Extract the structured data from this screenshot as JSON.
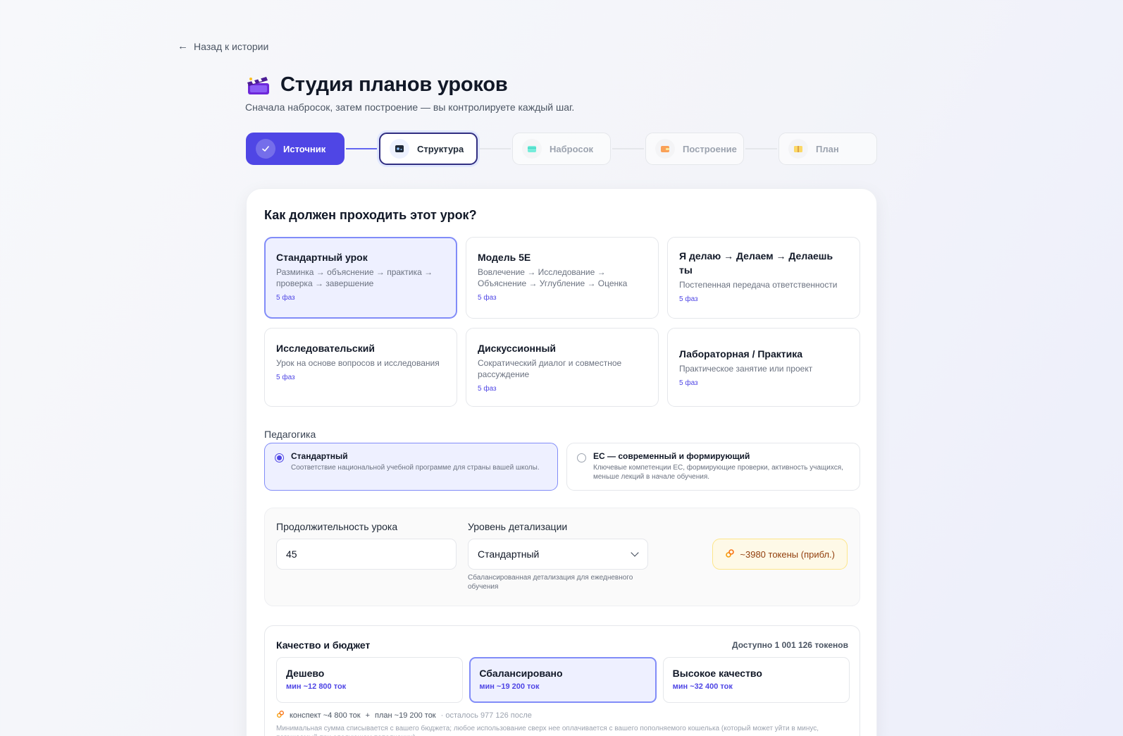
{
  "nav": {
    "back_label": "Назад к истории"
  },
  "header": {
    "title": "Студия планов уроков",
    "subtitle": "Сначала набросок, затем построение — вы контролируете каждый шаг."
  },
  "stepper": {
    "steps": [
      {
        "label": "Источник",
        "state": "done"
      },
      {
        "label": "Структура",
        "state": "active"
      },
      {
        "label": "Набросок",
        "state": "pending"
      },
      {
        "label": "Построение",
        "state": "pending"
      },
      {
        "label": "План",
        "state": "pending"
      }
    ]
  },
  "structure": {
    "question": "Как должен проходить этот урок?",
    "templates": [
      {
        "name": "Стандартный урок",
        "desc": "Разминка → объяснение → практика → проверка → завершение",
        "phases": "5 фаз",
        "selected": true
      },
      {
        "name": "Модель 5E",
        "desc": "Вовлечение → Исследование → Объяснение → Углубление → Оценка",
        "phases": "5 фаз",
        "selected": false
      },
      {
        "name": "Я делаю → Делаем → Делаешь ты",
        "desc": "Постепенная передача ответственности",
        "phases": "5 фаз",
        "selected": false
      },
      {
        "name": "Исследовательский",
        "desc": "Урок на основе вопросов и исследования",
        "phases": "5 фаз",
        "selected": false
      },
      {
        "name": "Дискуссионный",
        "desc": "Сократический диалог и совместное рассуждение",
        "phases": "5 фаз",
        "selected": false
      },
      {
        "name": "Лабораторная / Практика",
        "desc": "Практическое занятие или проект",
        "phases": "5 фаз",
        "selected": false
      }
    ]
  },
  "pedagogy": {
    "label": "Педагогика",
    "options": [
      {
        "name": "Стандартный",
        "desc": "Соответствие национальной учебной программе для страны вашей школы.",
        "selected": true
      },
      {
        "name": "ЕС — современный и формирующий",
        "desc": "Ключевые компетенции ЕС, формирующие проверки, активность учащихся, меньше лекций в начале обучения.",
        "selected": false
      }
    ]
  },
  "settings": {
    "duration_label": "Продолжительность урока",
    "duration_value": "45",
    "detail_label": "Уровень детализации",
    "detail_value": "Стандартный",
    "detail_help": "Сбалансированная детализация для ежедневного обучения",
    "token_estimate": "~3980 токены (прибл.)"
  },
  "quality": {
    "title": "Качество и бюджет",
    "available": "Доступно 1 001 126 токенов",
    "options": [
      {
        "name": "Дешево",
        "min": "мин ~12 800 ток",
        "selected": false
      },
      {
        "name": "Сбалансировано",
        "min": "мин ~19 200 ток",
        "selected": true
      },
      {
        "name": "Высокое качество",
        "min": "мин ~32 400 ток",
        "selected": false
      }
    ],
    "breakdown_outline": "конспект ~4 800 ток",
    "breakdown_plus": "+",
    "breakdown_plan": "план ~19 200 ток",
    "breakdown_remaining": "· осталось 977 126 после",
    "note": "Минимальная сумма списывается с вашего бюджета; любое использование сверх нее оплачивается с вашего пополняемого кошелька (который может уйти в минус, погашаемый при следующем пополнении)."
  },
  "colors": {
    "accent": "#4f46e5",
    "accent_light": "#eef0ff",
    "token_pill_bg": "#fef9e7",
    "token_pill_text": "#92400e"
  },
  "icons": {
    "back": "arrow-left-icon",
    "title": "clapperboard-icon",
    "step_done": "check-icon",
    "step_structure": "gamepad-icon",
    "step_outline": "card-icon",
    "step_build": "wallet-icon",
    "step_plan": "book-icon",
    "tokens": "link-icon",
    "select": "chevron-down-icon"
  }
}
